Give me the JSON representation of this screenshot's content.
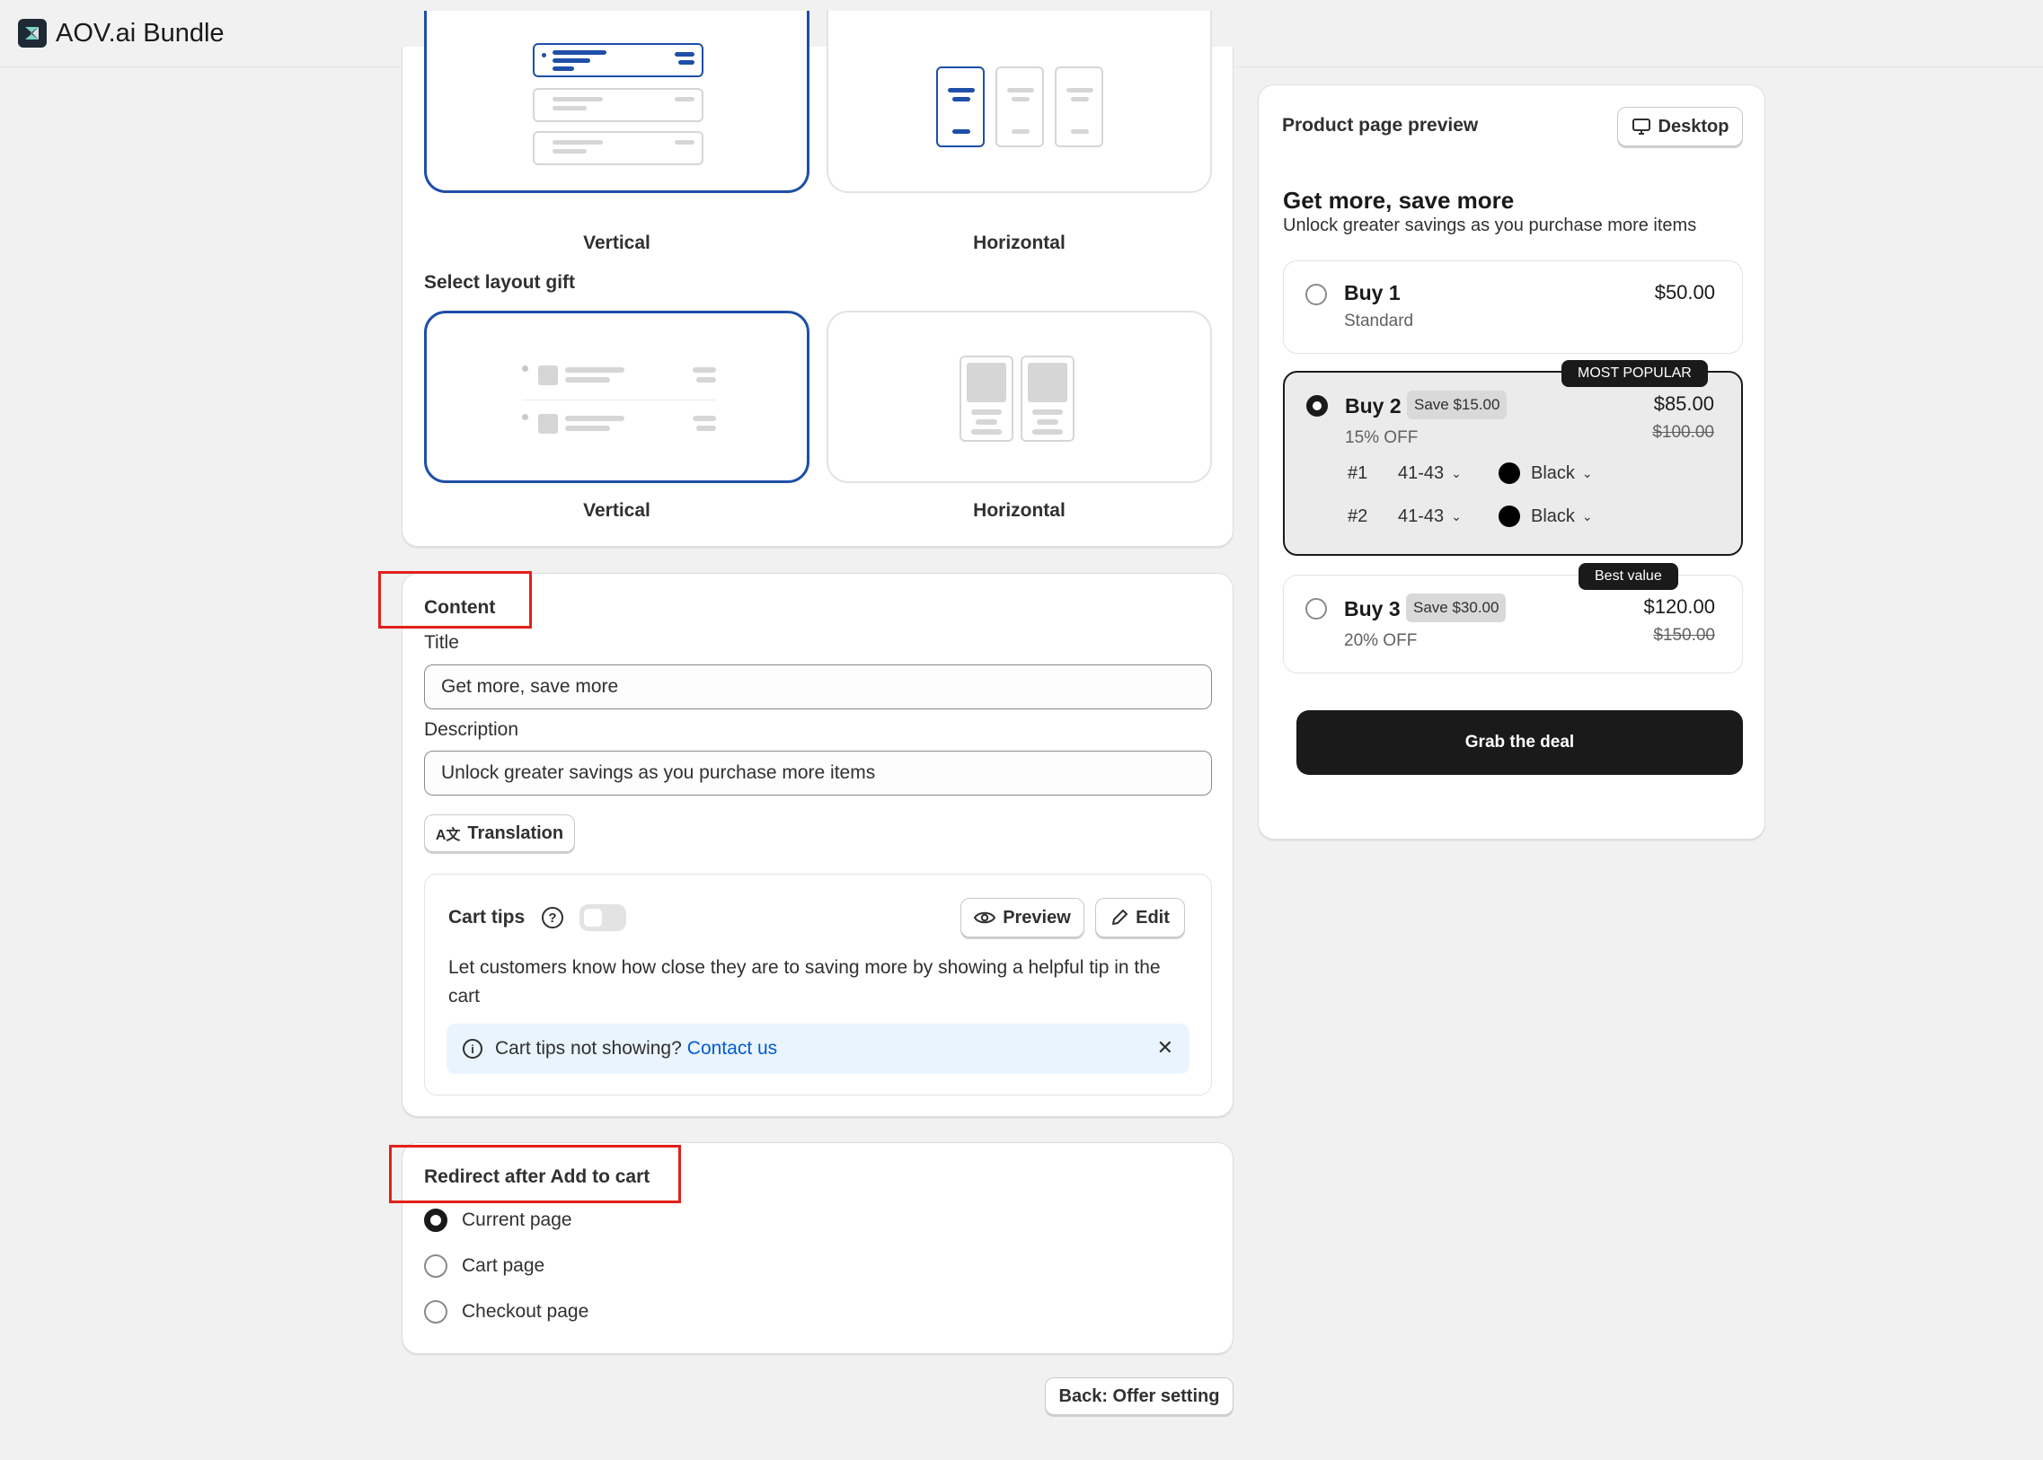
{
  "app": {
    "title": "AOV.ai Bundle",
    "logo_icon": "aov-logo-icon"
  },
  "layout_section": {
    "layout_options": [
      {
        "label": "Vertical",
        "selected": true
      },
      {
        "label": "Horizontal",
        "selected": false
      }
    ],
    "gift_heading": "Select layout gift",
    "gift_options": [
      {
        "label": "Vertical",
        "selected": true
      },
      {
        "label": "Horizontal",
        "selected": false
      }
    ]
  },
  "content_section": {
    "heading": "Content",
    "title_label": "Title",
    "title_value": "Get more, save more",
    "description_label": "Description",
    "description_value": "Unlock greater savings as you purchase more items",
    "translation_button": "Translation",
    "cart_tips": {
      "heading": "Cart tips",
      "enabled": false,
      "preview_button": "Preview",
      "edit_button": "Edit",
      "description": "Let customers know how close they are to saving more by showing a helpful tip in the cart",
      "banner_text": "Cart tips not showing?",
      "banner_link": "Contact us"
    }
  },
  "redirect_section": {
    "heading": "Redirect after Add to cart",
    "options": [
      {
        "label": "Current page",
        "checked": true
      },
      {
        "label": "Cart page",
        "checked": false
      },
      {
        "label": "Checkout page",
        "checked": false
      }
    ]
  },
  "footer": {
    "back_button": "Back: Offer setting"
  },
  "preview": {
    "heading": "Product page preview",
    "device_button": "Desktop",
    "title": "Get more, save more",
    "subtitle": "Unlock greater savings as you purchase more items",
    "tiers": [
      {
        "name": "Buy 1",
        "sub": "Standard",
        "price": "$50.00",
        "checked": false
      },
      {
        "name": "Buy 2",
        "save": "Save $15.00",
        "sub": "15% OFF",
        "price": "$85.00",
        "old_price": "$100.00",
        "badge": "MOST POPULAR",
        "checked": true,
        "variants": [
          {
            "index": "#1",
            "size": "41-43",
            "color": "Black"
          },
          {
            "index": "#2",
            "size": "41-43",
            "color": "Black"
          }
        ]
      },
      {
        "name": "Buy 3",
        "save": "Save $30.00",
        "sub": "20% OFF",
        "price": "$120.00",
        "old_price": "$150.00",
        "badge": "Best value",
        "checked": false
      }
    ],
    "cta": "Grab the deal"
  },
  "colors": {
    "accent_blue": "#1f4fa8",
    "link": "#005bd3",
    "highlight_red": "#e3201b",
    "dark": "#1a1a1a"
  }
}
